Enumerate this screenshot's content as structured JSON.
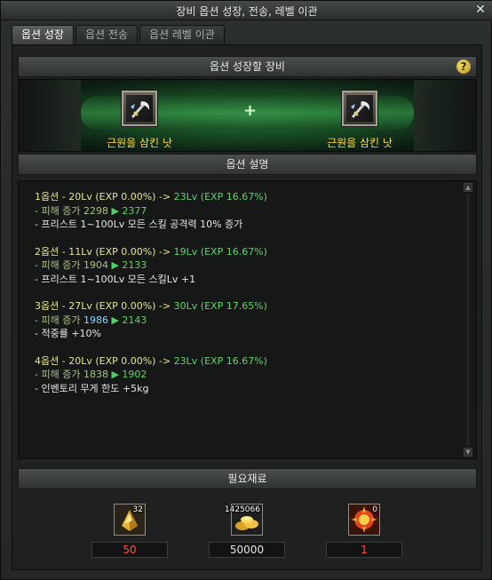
{
  "window": {
    "title": "장비 옵션 성장, 전송, 레벨 이관",
    "close_glyph": "✕"
  },
  "tabs": [
    {
      "label": "옵션 성장",
      "active": true
    },
    {
      "label": "옵션 전송",
      "active": false
    },
    {
      "label": "옵션 레벨 이관",
      "active": false
    }
  ],
  "gear_section": {
    "header": "옵션 성장할 장비",
    "help_glyph": "?",
    "plus_glyph": "+",
    "left_item": {
      "name": "근원을 삼킨 낫",
      "icon": "scythe-icon"
    },
    "right_item": {
      "name": "근원을 삼킨 낫",
      "icon": "scythe-icon"
    }
  },
  "description": {
    "header": "옵션 설명",
    "options": [
      {
        "head_before": "1옵션 - 20Lv (EXP 0.00%) -> ",
        "head_after": "23Lv (EXP 16.67%)",
        "damage_label": "- 피해 증가 ",
        "damage_from": "2298",
        "damage_to": "2377",
        "effect": "- 프리스트 1~100Lv 모든 스킬 공격력 10% 증가"
      },
      {
        "head_before": "2옵션 - 11Lv (EXP 0.00%) -> ",
        "head_after": "19Lv (EXP 16.67%)",
        "damage_label": "- 피해 증가 ",
        "damage_from": "1904",
        "damage_to": "2133",
        "effect": "- 프리스트 1~100Lv 모든 스킬Lv +1"
      },
      {
        "head_before": "3옵션 - 27Lv (EXP 0.00%) -> ",
        "head_after": "30Lv (EXP 17.65%)",
        "damage_label": "- 피해 증가 ",
        "damage_from": "1986",
        "damage_to": "2143",
        "effect": "- 적중률 +10%"
      },
      {
        "head_before": "4옵션 - 20Lv (EXP 0.00%) -> ",
        "head_after": "23Lv (EXP 16.67%)",
        "damage_label": "- 피해 증가 ",
        "damage_from": "1838",
        "damage_to": "1902",
        "effect": "- 인벤토리 무게 한도 +5kg"
      }
    ]
  },
  "materials": {
    "header": "필요재료",
    "items": [
      {
        "icon": "gold-crystal-icon",
        "owned": "32",
        "required": "50"
      },
      {
        "icon": "gold-coins-icon",
        "owned": "1425066",
        "required": "50000"
      },
      {
        "icon": "red-orb-icon",
        "owned": "0",
        "required": "1"
      }
    ]
  },
  "colors": {
    "item_name": "#ffd84a",
    "option_text": "#e8e38f",
    "option_result": "#5fd46a",
    "damage_line": "#a9c089",
    "insufficient": "#ff4a4a"
  }
}
